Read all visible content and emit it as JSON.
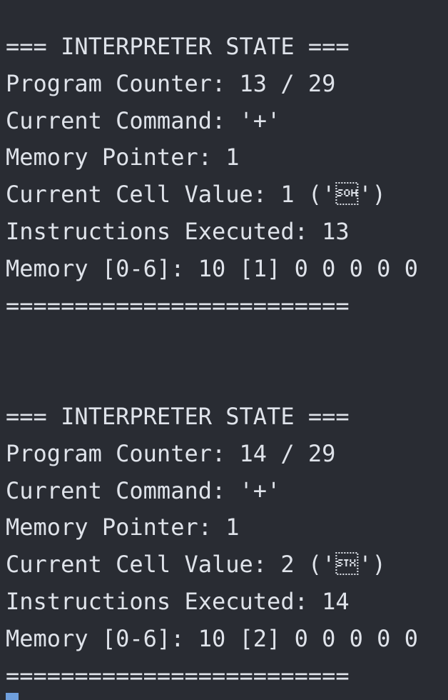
{
  "terminal": {
    "blocks": [
      {
        "header": "=== INTERPRETER STATE ===",
        "program_counter": "Program Counter: 13 / 29",
        "current_command": "Current Command: '+'",
        "memory_pointer": "Memory Pointer: 1",
        "current_cell_value": "Current Cell Value: 1 ('\u0001')",
        "instructions_executed": "Instructions Executed: 13",
        "memory": "Memory [0-6]: 10 [1] 0 0 0 0 0",
        "footer": "========================="
      },
      {
        "header": "=== INTERPRETER STATE ===",
        "program_counter": "Program Counter: 14 / 29",
        "current_command": "Current Command: '+'",
        "memory_pointer": "Memory Pointer: 1",
        "current_cell_value": "Current Cell Value: 2 ('\u0002')",
        "instructions_executed": "Instructions Executed: 14",
        "memory": "Memory [0-6]: 10 [2] 0 0 0 0 0",
        "footer": "========================="
      }
    ],
    "colors": {
      "background": "#292c33",
      "text": "#dfe3ea",
      "cursor": "#6f9fdc"
    }
  }
}
